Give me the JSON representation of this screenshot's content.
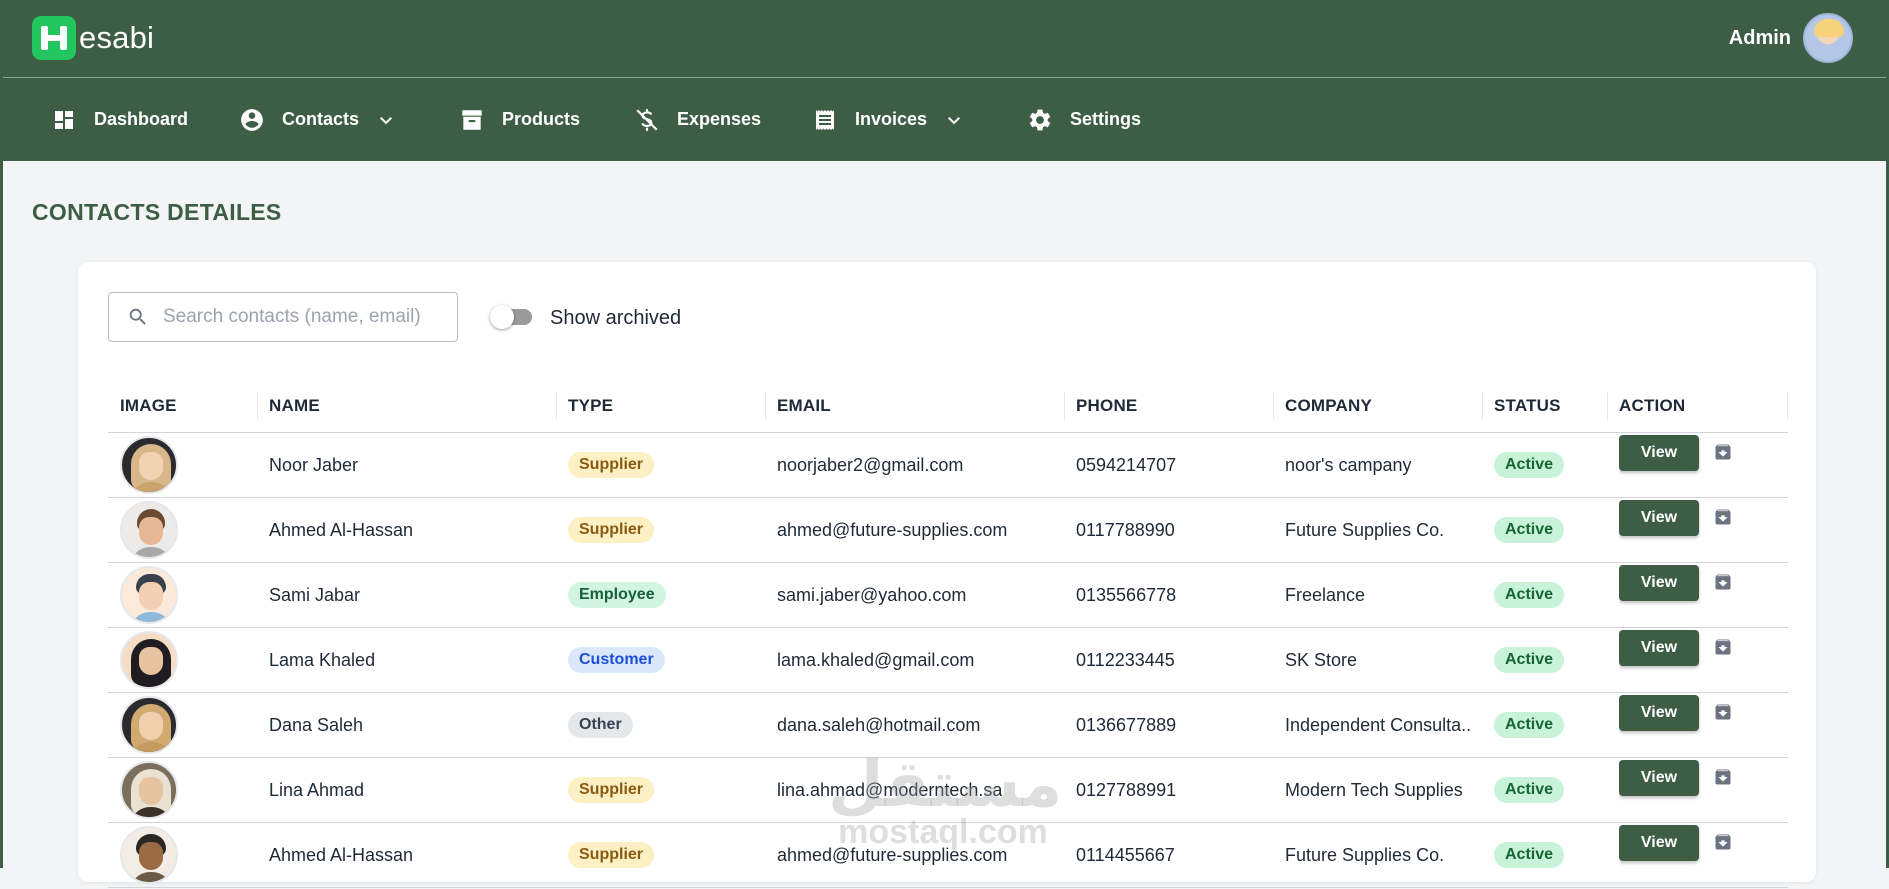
{
  "app": {
    "logo_text": "esabi",
    "user_name": "Admin",
    "accent": "#3d5e45",
    "logo_color": "#22c55e"
  },
  "nav": {
    "items": [
      {
        "label": "Dashboard",
        "icon": "dashboard-icon",
        "has_dropdown": false
      },
      {
        "label": "Contacts",
        "icon": "account-circle-icon",
        "has_dropdown": true
      },
      {
        "label": "Products",
        "icon": "archive-box-icon",
        "has_dropdown": false
      },
      {
        "label": "Expenses",
        "icon": "money-off-icon",
        "has_dropdown": false
      },
      {
        "label": "Invoices",
        "icon": "receipt-icon",
        "has_dropdown": true
      },
      {
        "label": "Settings",
        "icon": "gear-icon",
        "has_dropdown": false
      }
    ]
  },
  "page": {
    "title": "CONTACTS DETAILES"
  },
  "search": {
    "placeholder": "Search contacts (name, email)",
    "value": ""
  },
  "archived_toggle": {
    "label": "Show archived",
    "on": false
  },
  "table": {
    "columns": [
      "IMAGE",
      "NAME",
      "TYPE",
      "EMAIL",
      "PHONE",
      "COMPANY",
      "STATUS",
      "ACTION"
    ],
    "view_label": "View",
    "rows": [
      {
        "name": "Noor Jaber",
        "type": "Supplier",
        "email": "noorjaber2@gmail.com",
        "phone": "0594214707",
        "company": "noor's campany",
        "status": "Active"
      },
      {
        "name": "Ahmed Al-Hassan",
        "type": "Supplier",
        "email": "ahmed@future-supplies.com",
        "phone": "0117788990",
        "company": "Future Supplies Co.",
        "status": "Active"
      },
      {
        "name": "Sami Jabar",
        "type": "Employee",
        "email": "sami.jaber@yahoo.com",
        "phone": "0135566778",
        "company": "Freelance",
        "status": "Active"
      },
      {
        "name": "Lama Khaled",
        "type": "Customer",
        "email": "lama.khaled@gmail.com",
        "phone": "0112233445",
        "company": "SK Store",
        "status": "Active"
      },
      {
        "name": "Dana Saleh",
        "type": "Other",
        "email": "dana.saleh@hotmail.com",
        "phone": "0136677889",
        "company": "Independent Consulta...",
        "status": "Active"
      },
      {
        "name": "Lina Ahmad",
        "type": "Supplier",
        "email": "lina.ahmad@moderntech.sa",
        "phone": "0127788991",
        "company": "Modern Tech Supplies",
        "status": "Active"
      },
      {
        "name": "Ahmed Al-Hassan",
        "type": "Supplier",
        "email": "ahmed@future-supplies.com",
        "phone": "0114455667",
        "company": "Future Supplies Co.",
        "status": "Active"
      }
    ]
  },
  "watermark": {
    "arabic": "مستقل",
    "latin": "mostaql.com"
  }
}
